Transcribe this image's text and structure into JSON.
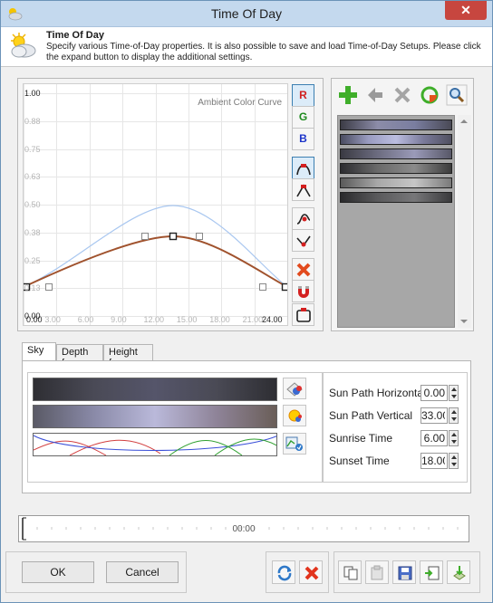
{
  "window": {
    "title": "Time Of Day",
    "close_label": "✕"
  },
  "header": {
    "title": "Time Of Day",
    "description": "Specify various Time-of-Day properties. It is also possible to save and load Time-of-Day Setups. Please click the expand button to display the additional settings."
  },
  "graph": {
    "curve_label": "Ambient Color Curve",
    "y_ticks": [
      "1.00",
      "0.88",
      "0.75",
      "0.63",
      "0.50",
      "0.38",
      "0.25",
      "0.13",
      "0.00"
    ],
    "x_ticks": [
      "0.00",
      "3.00",
      "6.00",
      "9.00",
      "12.00",
      "15.00",
      "18.00",
      "21.00",
      "24.00"
    ],
    "channel_buttons": {
      "r": "R",
      "g": "G",
      "b": "B"
    },
    "colors": {
      "curve": "#a0522d",
      "ghost_curve": "#a9c7f0"
    }
  },
  "presets": {
    "icons": [
      "add-icon",
      "back-icon",
      "delete-icon",
      "refresh-icon",
      "zoom-icon"
    ]
  },
  "tabs": [
    {
      "label": "Sky"
    },
    {
      "label": "Depth fog"
    },
    {
      "label": "Height fog"
    }
  ],
  "sky": {
    "sun_path_horizontal": {
      "label": "Sun Path Horizontal",
      "value": "0.00"
    },
    "sun_path_vertical": {
      "label": "Sun Path Vertical",
      "value": "33.00"
    },
    "sunrise_time": {
      "label": "Sunrise Time",
      "value": "6.00"
    },
    "sunset_time": {
      "label": "Sunset Time",
      "value": "18.00"
    }
  },
  "timeline": {
    "time": "00:00"
  },
  "buttons": {
    "ok": "OK",
    "cancel": "Cancel"
  }
}
